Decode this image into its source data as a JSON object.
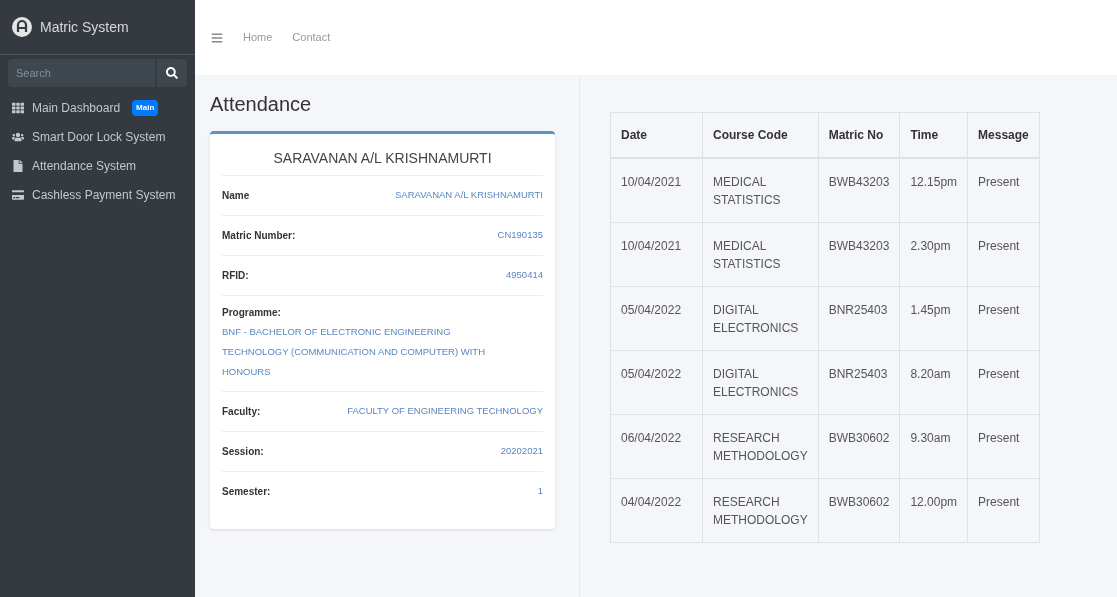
{
  "sidebar": {
    "brand": "Matric System",
    "search": {
      "placeholder": "Search"
    },
    "items": [
      {
        "label": "Main Dashboard",
        "kind": "grid",
        "badge": "Main"
      },
      {
        "label": "Smart Door Lock System",
        "kind": "users"
      },
      {
        "label": "Attendance System",
        "kind": "file"
      },
      {
        "label": "Cashless Payment System",
        "kind": "card"
      }
    ]
  },
  "navbar": {
    "links": [
      "Home",
      "Contact"
    ]
  },
  "page_title": "Attendance",
  "profile": {
    "name": "SARAVANAN A/L KRISHNAMURTI",
    "fields": [
      {
        "label": "Name",
        "value": "SARAVANAN A/L KRISHNAMURTI",
        "kind": "inline"
      },
      {
        "label": "Matric Number:",
        "value": "CN190135",
        "kind": "inline"
      },
      {
        "label": "RFID:",
        "value": "4950414",
        "kind": "inline"
      },
      {
        "label": "Programme:",
        "value": "BNF - BACHELOR OF ELECTRONIC ENGINEERING TECHNOLOGY (COMMUNICATION AND COMPUTER) WITH HONOURS",
        "kind": "block"
      },
      {
        "label": "Faculty:",
        "value": "FACULTY OF ENGINEERING TECHNOLOGY",
        "kind": "inline"
      },
      {
        "label": "Session:",
        "value": "20202021",
        "kind": "inline"
      },
      {
        "label": "Semester:",
        "value": "1",
        "kind": "inline"
      }
    ]
  },
  "table": {
    "columns": [
      "Date",
      "Course Code",
      "Matric No",
      "Time",
      "Message"
    ],
    "rows": [
      [
        "10/04/2021",
        "MEDICAL STATISTICS",
        "BWB43203",
        "12.15pm",
        "Present"
      ],
      [
        "10/04/2021",
        "MEDICAL STATISTICS",
        "BWB43203",
        "2.30pm",
        "Present"
      ],
      [
        "05/04/2022",
        "DIGITAL ELECTRONICS",
        "BNR25403",
        "1.45pm",
        "Present"
      ],
      [
        "05/04/2022",
        "DIGITAL ELECTRONICS",
        "BNR25403",
        "8.20am",
        "Present"
      ],
      [
        "06/04/2022",
        "RESEARCH METHODOLOGY",
        "BWB30602",
        "9.30am",
        "Present"
      ],
      [
        "04/04/2022",
        "RESEARCH METHODOLOGY",
        "BWB30602",
        "12.00pm",
        "Present"
      ]
    ]
  }
}
